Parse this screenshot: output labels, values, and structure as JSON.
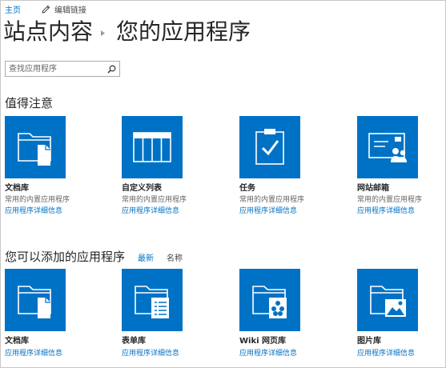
{
  "nav": {
    "home": "主页",
    "edit_links": "编辑链接"
  },
  "title": {
    "root": "站点内容",
    "current": "您的应用程序"
  },
  "search": {
    "placeholder": "查找应用程序"
  },
  "noteworthy": {
    "heading": "值得注意",
    "tiles": [
      {
        "name": "文档库",
        "description": "常用的内置应用程序",
        "details": "应用程序详细信息",
        "icon": "document-library-icon"
      },
      {
        "name": "自定义列表",
        "description": "常用的内置应用程序",
        "details": "应用程序详细信息",
        "icon": "custom-list-icon"
      },
      {
        "name": "任务",
        "description": "常用的内置应用程序",
        "details": "应用程序详细信息",
        "icon": "tasks-icon"
      },
      {
        "name": "网站邮箱",
        "description": "常用的内置应用程序",
        "details": "应用程序详细信息",
        "icon": "site-mailbox-icon"
      }
    ]
  },
  "addable": {
    "heading": "您可以添加的应用程序",
    "sort_newest": "最新",
    "sort_name": "名称",
    "tiles": [
      {
        "name": "文档库",
        "details": "应用程序详细信息",
        "icon": "document-library-icon"
      },
      {
        "name": "表单库",
        "details": "应用程序详细信息",
        "icon": "form-library-icon"
      },
      {
        "name": "Wiki 网页库",
        "details": "应用程序详细信息",
        "icon": "wiki-page-library-icon"
      },
      {
        "name": "图片库",
        "details": "应用程序详细信息",
        "icon": "picture-library-icon"
      }
    ]
  },
  "colors": {
    "accent": "#0072c6",
    "text": "#444444",
    "heading": "#262626"
  }
}
